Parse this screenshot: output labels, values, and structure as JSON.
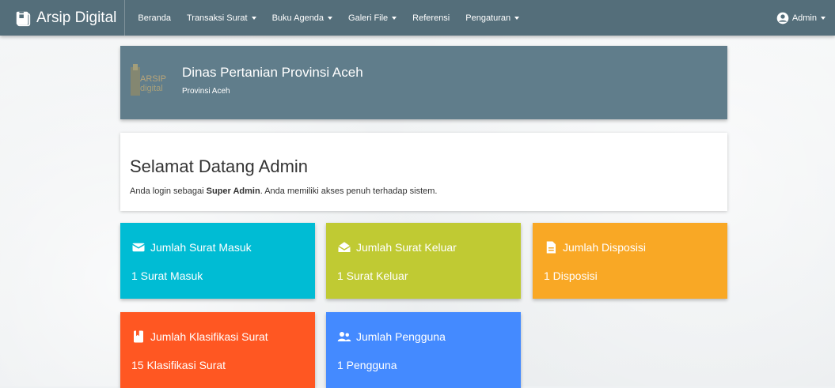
{
  "navbar": {
    "brand": "Arsip Digital",
    "menu": [
      {
        "label": "Beranda",
        "dropdown": false
      },
      {
        "label": "Transaksi Surat",
        "dropdown": true
      },
      {
        "label": "Buku Agenda",
        "dropdown": true
      },
      {
        "label": "Galeri File",
        "dropdown": true
      },
      {
        "label": "Referensi",
        "dropdown": false
      },
      {
        "label": "Pengaturan",
        "dropdown": true
      }
    ],
    "user": "Admin"
  },
  "header": {
    "logo_text": "ARSIP digital",
    "org_name": "Dinas Pertanian Provinsi Aceh",
    "org_sub": "Provinsi Aceh"
  },
  "welcome": {
    "title": "Selamat Datang Admin",
    "text_prefix": "Anda login sebagai ",
    "role": "Super Admin",
    "text_suffix": ". Anda memiliki akses penuh terhadap sistem."
  },
  "tiles": [
    {
      "title": "Jumlah Surat Masuk",
      "value": "1 Surat Masuk",
      "icon": "envelope-icon",
      "color": "#00bcd4"
    },
    {
      "title": "Jumlah Surat Keluar",
      "value": "1 Surat Keluar",
      "icon": "envelope-open-icon",
      "color": "#c0ca33"
    },
    {
      "title": "Jumlah Disposisi",
      "value": "1 Disposisi",
      "icon": "file-icon",
      "color": "#f9a825"
    },
    {
      "title": "Jumlah Klasifikasi Surat",
      "value": "15 Klasifikasi Surat",
      "icon": "bookmark-icon",
      "color": "#ff5722"
    },
    {
      "title": "Jumlah Pengguna",
      "value": "1 Pengguna",
      "icon": "users-icon",
      "color": "#448aff"
    }
  ]
}
